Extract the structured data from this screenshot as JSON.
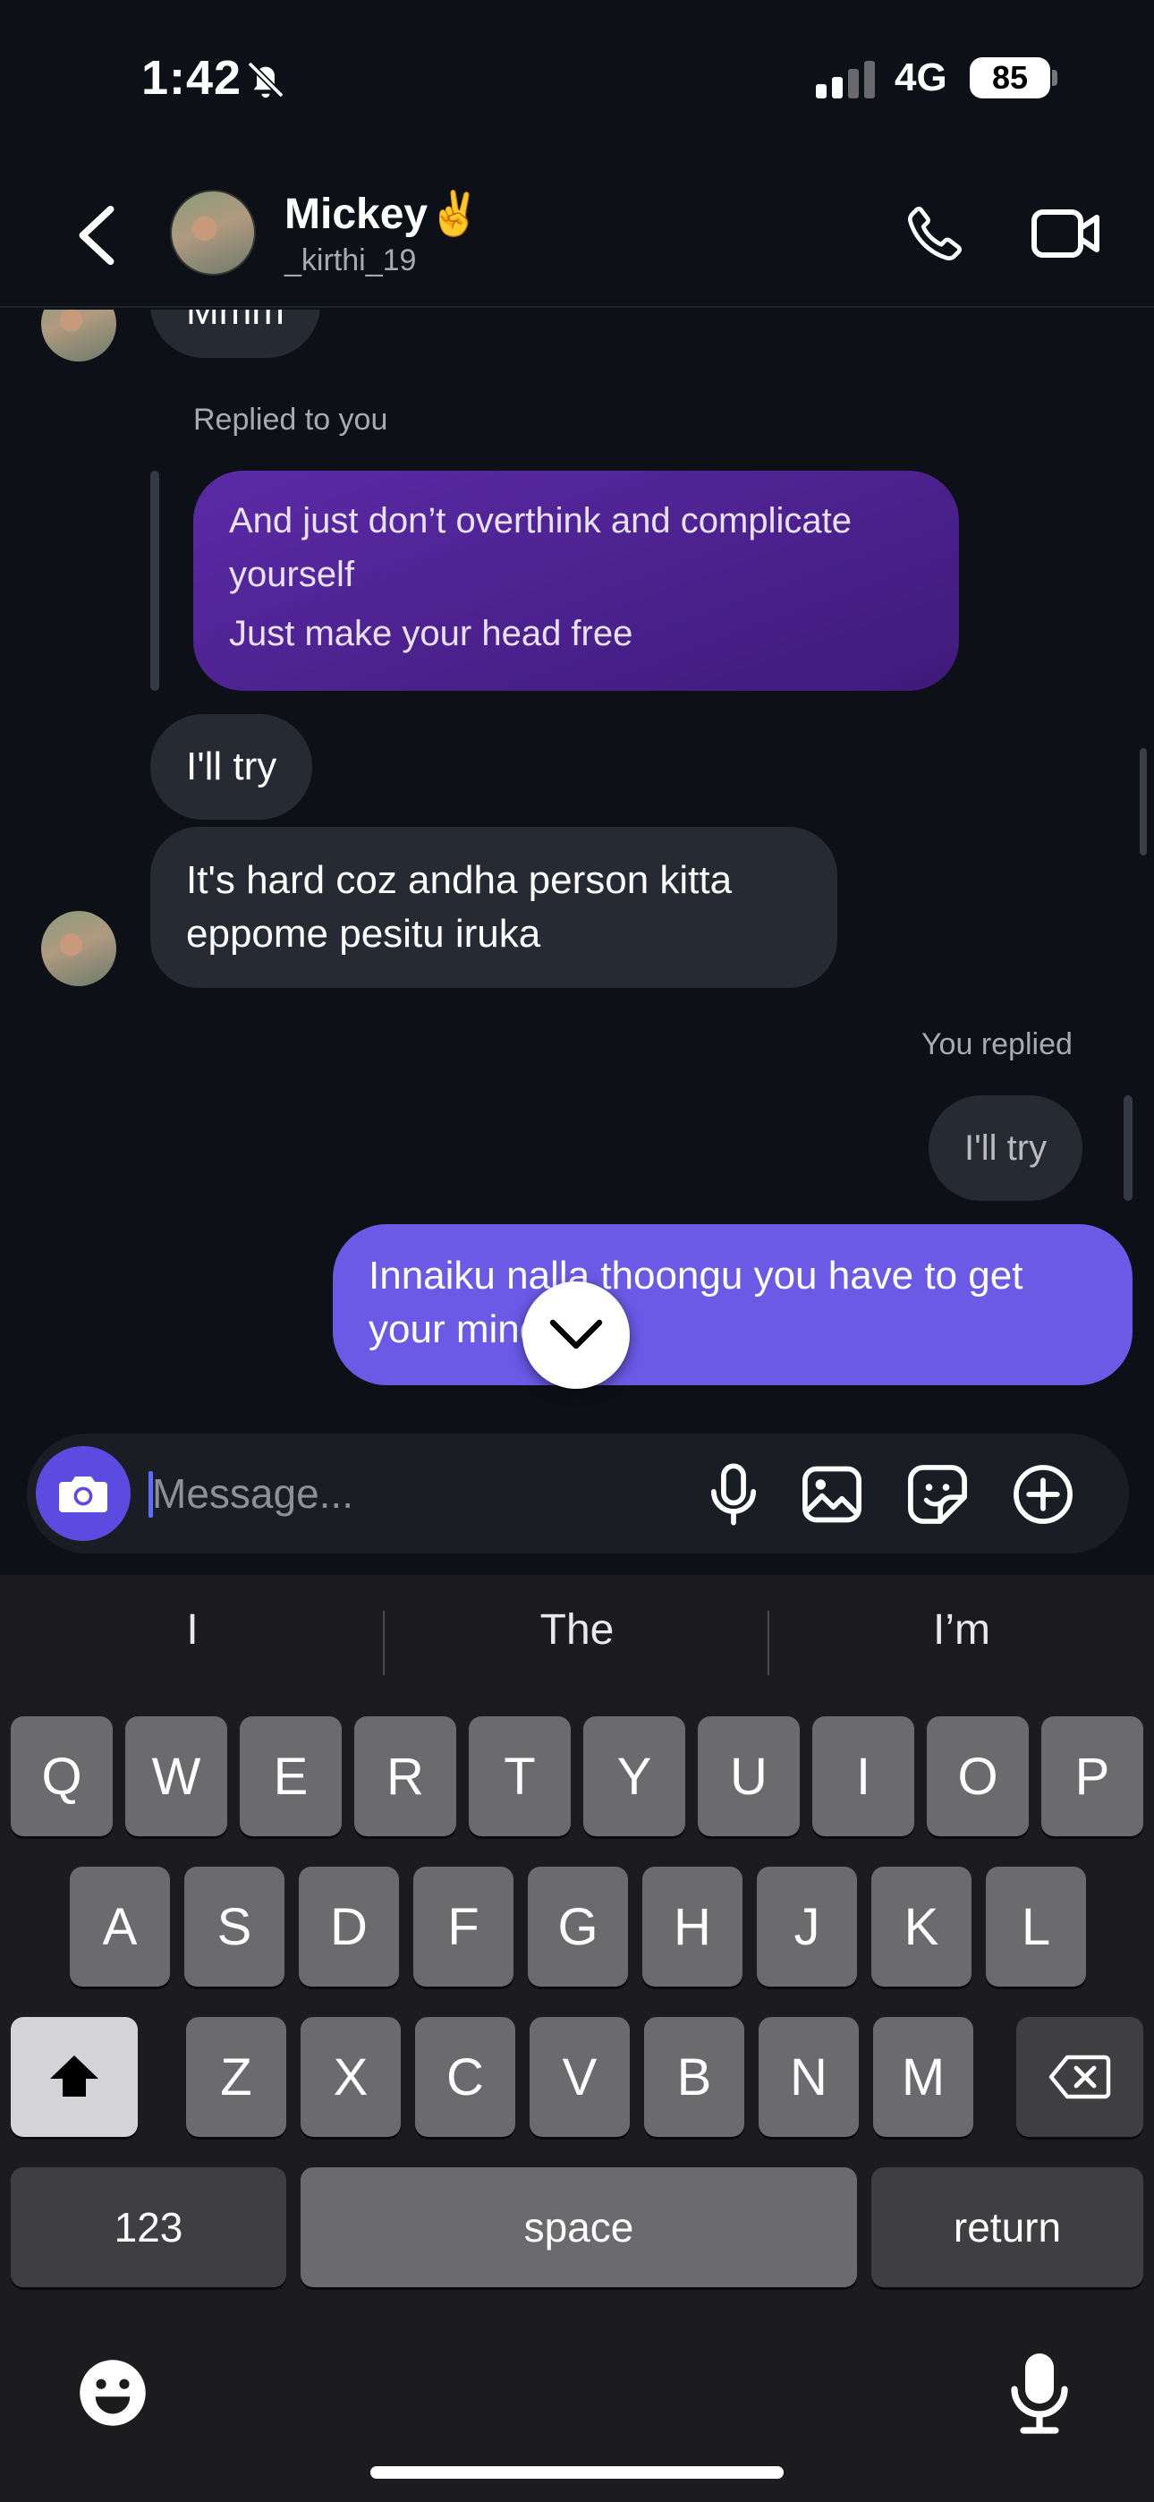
{
  "status": {
    "time": "1:42",
    "network": "4G",
    "battery": "85"
  },
  "header": {
    "name": "Mickey✌️",
    "handle": "_kirthi_19"
  },
  "chat": {
    "clipped_message": "Mmm",
    "replied_label_1": "Replied to you",
    "quoted_lines": [
      "And just don’t overthink and complicate",
      "yourself",
      "Just make your head free"
    ],
    "msg_try": "I'll try",
    "msg_hard_lines": [
      "It's hard coz andha person kitta",
      "eppome pesitu iruka"
    ],
    "replied_label_2": "You replied",
    "quoted_try": "I'll try",
    "msg_sent_lines": [
      "Innaiku nalla thoongu you have to get",
      "your mind free"
    ]
  },
  "composer": {
    "placeholder": "Message..."
  },
  "keyboard": {
    "suggestions": [
      "I",
      "The",
      "I’m"
    ],
    "row1": [
      "Q",
      "W",
      "E",
      "R",
      "T",
      "Y",
      "U",
      "I",
      "O",
      "P"
    ],
    "row2": [
      "A",
      "S",
      "D",
      "F",
      "G",
      "H",
      "J",
      "K",
      "L"
    ],
    "row3": [
      "Z",
      "X",
      "C",
      "V",
      "B",
      "N",
      "M"
    ],
    "numbers_label": "123",
    "space_label": "space",
    "return_label": "return"
  },
  "icons": {
    "back": "chevron-left-icon",
    "phone": "phone-icon",
    "video": "video-icon",
    "camera": "camera-icon",
    "mic": "microphone-icon",
    "gallery": "image-icon",
    "sticker": "sticker-icon",
    "plus": "plus-circle-icon",
    "jump": "chevron-down-icon",
    "shift": "shift-icon",
    "backspace": "backspace-icon",
    "emoji": "emoji-icon",
    "dictation": "dictation-icon"
  },
  "colors": {
    "sent_bubble": "#6a5ae6",
    "quoted_bubble": "#4a1f8f",
    "received_bubble": "#262a33",
    "camera_button": "#5b4be0"
  }
}
